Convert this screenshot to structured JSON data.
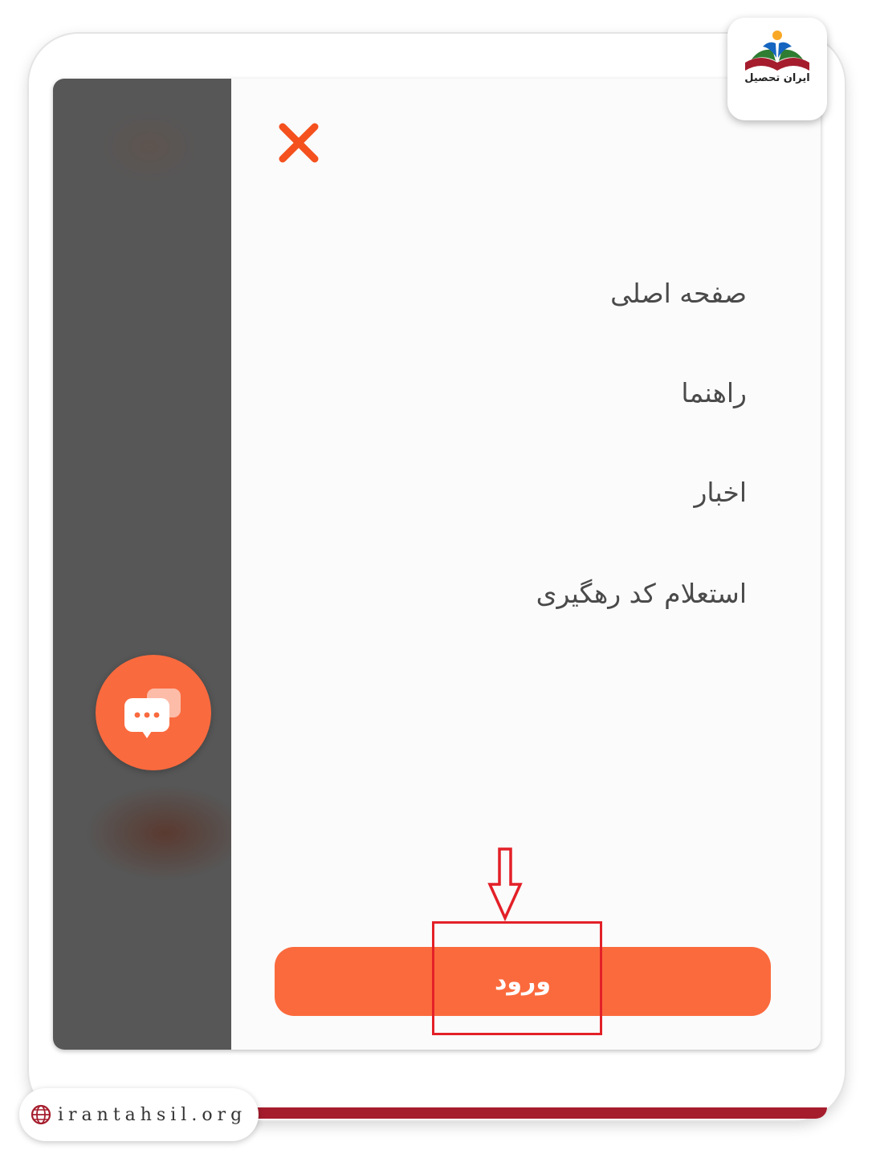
{
  "branding": {
    "logo_text": "ایران تحصیل",
    "website": "irantahsil.org"
  },
  "menu": {
    "close_icon": "close-icon",
    "items": [
      {
        "label": "صفحه اصلی"
      },
      {
        "label": "راهنما"
      },
      {
        "label": "اخبار"
      },
      {
        "label": "استعلام کد رهگیری"
      }
    ],
    "login_label": "ورود"
  },
  "chat": {
    "icon": "chat-bubbles-icon"
  },
  "colors": {
    "accent": "#fb6a3d",
    "close": "#f4511e",
    "annotation": "#e32028",
    "brand_red": "#a51d2d",
    "overlay": "#575757"
  }
}
